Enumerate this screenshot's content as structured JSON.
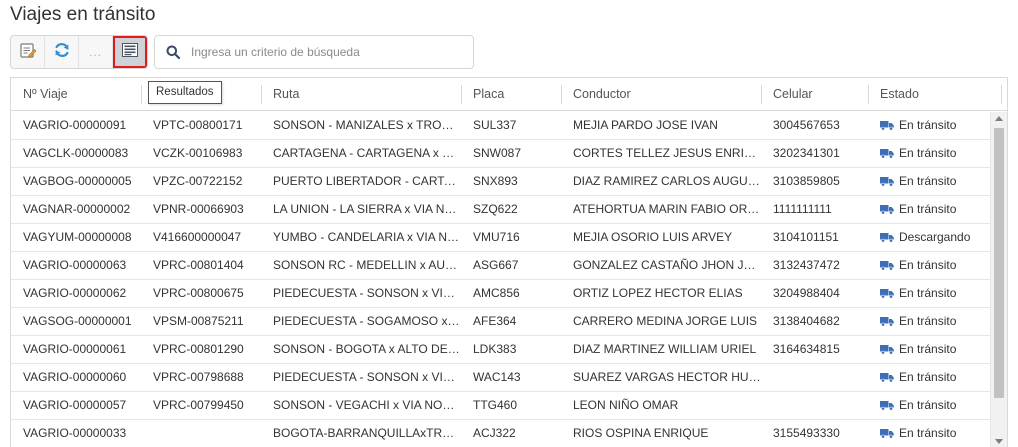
{
  "page": {
    "title": "Viajes en tránsito"
  },
  "toolbar": {
    "more_label": "...",
    "tooltip": "Resultados"
  },
  "search": {
    "placeholder": "Ingresa un criterio de búsqueda"
  },
  "colors": {
    "truck": "#3d6fb6",
    "active_outline": "#e01b1b",
    "refresh": "#2f8fd8"
  },
  "icons": {
    "edit": "edit-list-icon",
    "refresh": "refresh-icon",
    "results": "results-list-icon",
    "search": "search-icon",
    "truck": "truck-icon"
  },
  "columns": [
    "Nº Viaje",
    "",
    "Ruta",
    "Placa",
    "Conductor",
    "Celular",
    "Estado"
  ],
  "rows": [
    {
      "viaje": "VAGRIO-00000091",
      "manifiesto": "VPTC-00800171",
      "ruta": "SONSON - MANIZALES x TRONCAL DE OCCIDENTE",
      "placa": "SUL337",
      "conductor": "MEJIA PARDO JOSE IVAN",
      "celular": "3004567653",
      "estado": "En tránsito"
    },
    {
      "viaje": "VAGCLK-00000083",
      "manifiesto": "VCZK-00106983",
      "ruta": "CARTAGENA - CARTAGENA x VIA NORMAL",
      "placa": "SNW087",
      "conductor": "CORTES TELLEZ JESUS ENRIQUE",
      "celular": "3202341301",
      "estado": "En tránsito"
    },
    {
      "viaje": "VAGBOG-00000005",
      "manifiesto": "VPZC-00722152",
      "ruta": "PUERTO LIBERTADOR - CARTAGENA x VIA NORMAL",
      "placa": "SNX893",
      "conductor": "DIAZ RAMIREZ CARLOS AUGUSTO",
      "celular": "3103859805",
      "estado": "En tránsito"
    },
    {
      "viaje": "VAGNAR-00000002",
      "manifiesto": "VPNR-00066903",
      "ruta": "LA UNION - LA SIERRA x VIA NORMAL",
      "placa": "SZQ622",
      "conductor": "ATEHORTUA MARIN FABIO ORLANDO",
      "celular": "1111111111",
      "estado": "En tránsito"
    },
    {
      "viaje": "VAGYUM-00000008",
      "manifiesto": "V416600000047",
      "ruta": "YUMBO - CANDELARIA x VIA NORMAL",
      "placa": "VMU716",
      "conductor": "MEJIA OSORIO LUIS ARVEY",
      "celular": "3104101151",
      "estado": "Descargando"
    },
    {
      "viaje": "VAGRIO-00000063",
      "manifiesto": "VPRC-00801404",
      "ruta": "SONSON RC - MEDELLIN x AUTOPISTA",
      "placa": "ASG667",
      "conductor": "GONZALEZ CASTAÑO JHON JAIRO",
      "celular": "3132437472",
      "estado": "En tránsito"
    },
    {
      "viaje": "VAGRIO-00000062",
      "manifiesto": "VPRC-00800675",
      "ruta": "PIEDECUESTA - SONSON x VIA NORMAL",
      "placa": "AMC856",
      "conductor": "ORTIZ LOPEZ HECTOR ELIAS",
      "celular": "3204988404",
      "estado": "En tránsito"
    },
    {
      "viaje": "VAGSOG-00000001",
      "manifiesto": "VPSM-00875211",
      "ruta": "PIEDECUESTA - SOGAMOSO x VIA NORMAL",
      "placa": "AFE364",
      "conductor": "CARRERO MEDINA JORGE LUIS",
      "celular": "3138404682",
      "estado": "En tránsito"
    },
    {
      "viaje": "VAGRIO-00000061",
      "manifiesto": "VPRC-00801290",
      "ruta": "SONSON - BOGOTA x ALTO DE LETRAS",
      "placa": "LDK383",
      "conductor": "DIAZ MARTINEZ WILLIAM URIEL",
      "celular": "3164634815",
      "estado": "En tránsito"
    },
    {
      "viaje": "VAGRIO-00000060",
      "manifiesto": "VPRC-00798688",
      "ruta": "PIEDECUESTA - SONSON x VIA NORMAL",
      "placa": "WAC143",
      "conductor": "SUAREZ VARGAS HECTOR HUGO",
      "celular": "",
      "estado": "En tránsito"
    },
    {
      "viaje": "VAGRIO-00000057",
      "manifiesto": "VPRC-00799450",
      "ruta": "SONSON - VEGACHI x VIA NORMAL",
      "placa": "TTG460",
      "conductor": "LEON NIÑO OMAR",
      "celular": "",
      "estado": "En tránsito"
    },
    {
      "viaje": "VAGRIO-00000033",
      "manifiesto": "",
      "ruta": "BOGOTA-BARRANQUILLAxTRONCAL",
      "placa": "ACJ322",
      "conductor": "RIOS OSPINA ENRIQUE",
      "celular": "3155493330",
      "estado": "En tránsito"
    }
  ]
}
